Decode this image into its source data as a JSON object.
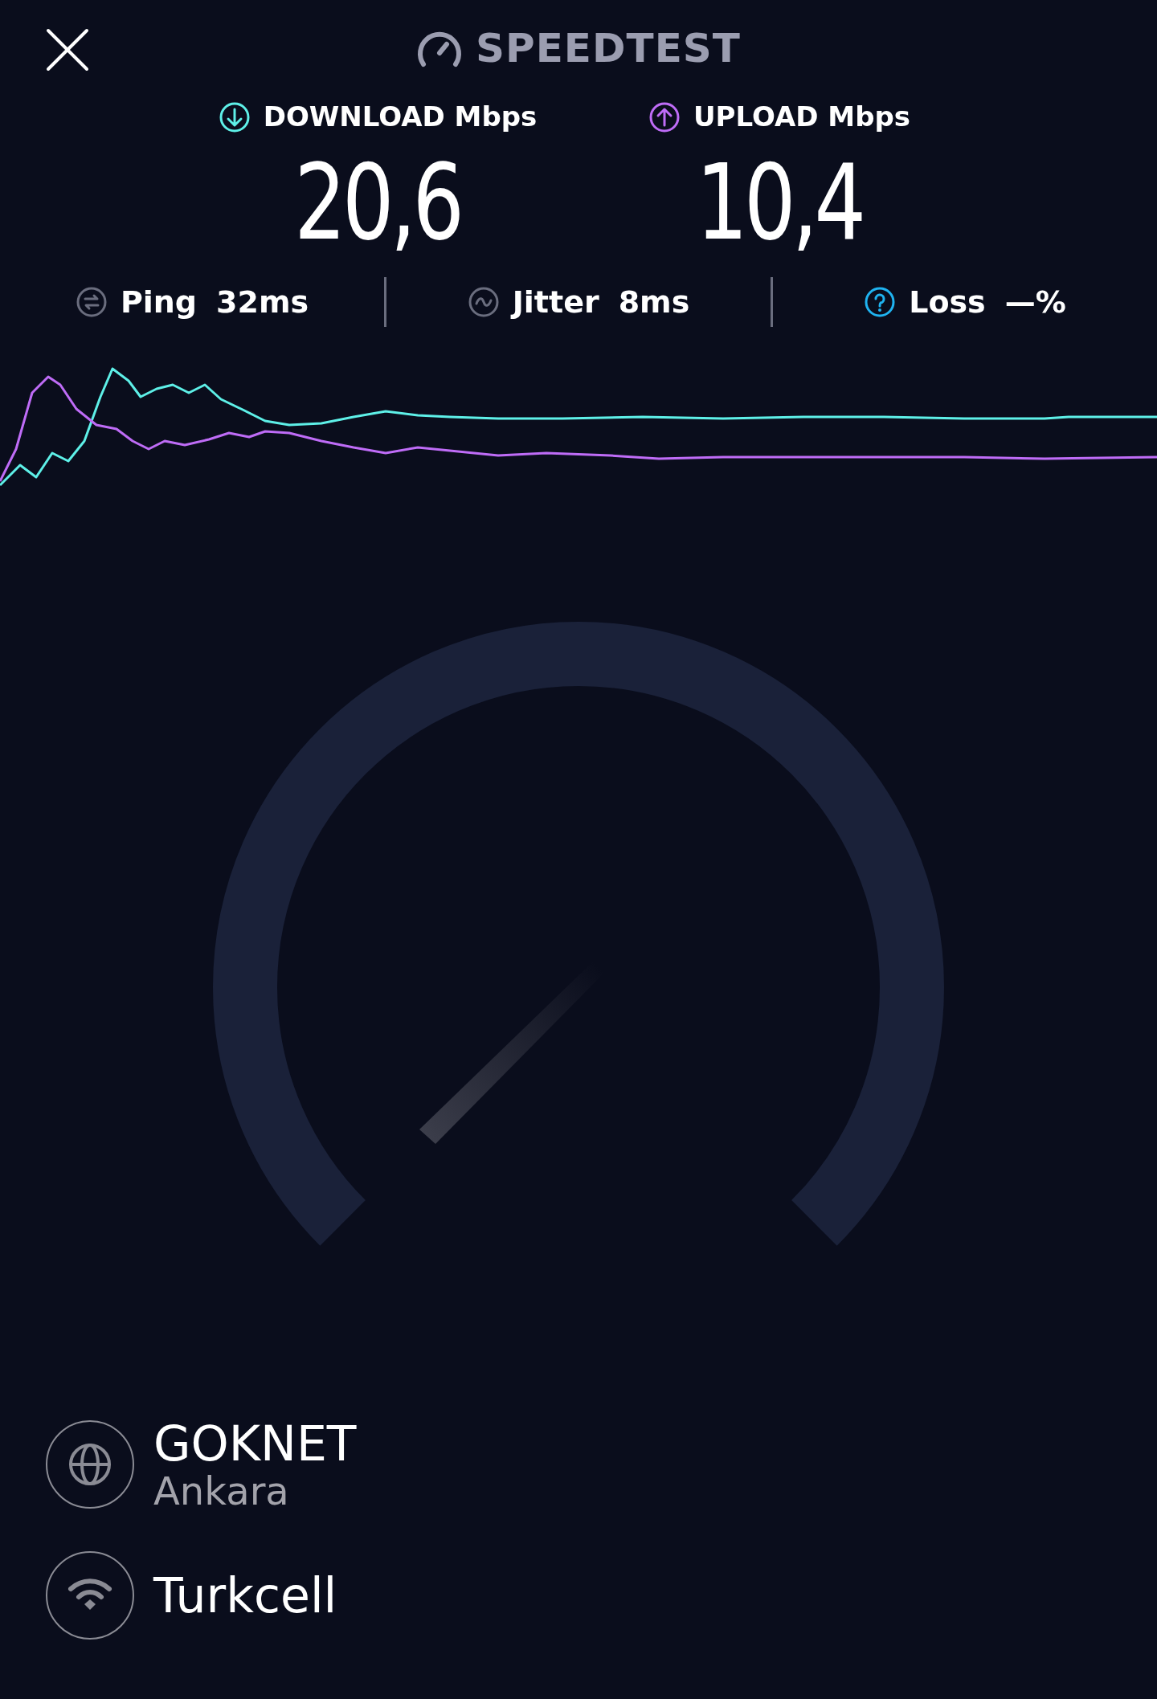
{
  "title": "SPEEDTEST",
  "results": [
    {
      "kind": "download",
      "label": "DOWNLOAD Mbps",
      "value": "20,6",
      "color": "#5ef0e8"
    },
    {
      "kind": "upload",
      "label": "UPLOAD Mbps",
      "value": "10,4",
      "color": "#bf6cf7"
    }
  ],
  "stats": [
    {
      "kind": "ping",
      "label": "Ping",
      "value": "32ms"
    },
    {
      "kind": "jitter",
      "label": "Jitter",
      "value": "8ms"
    },
    {
      "kind": "loss",
      "label": "Loss",
      "value": "—%"
    }
  ],
  "connections": [
    {
      "kind": "server",
      "name": "GOKNET",
      "location": "Ankara"
    },
    {
      "kind": "provider",
      "name": "Turkcell"
    }
  ]
}
